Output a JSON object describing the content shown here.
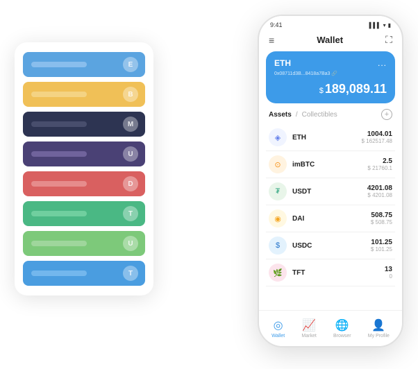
{
  "scene": {
    "cards": [
      {
        "color": "#5ba4e0",
        "textColor": "#a8d0f5",
        "dotLabel": "E"
      },
      {
        "color": "#f0c057",
        "textColor": "#f7e0a0",
        "dotLabel": "B"
      },
      {
        "color": "#2d3452",
        "textColor": "#5a6080",
        "dotLabel": "M"
      },
      {
        "color": "#4a4175",
        "textColor": "#8a7ab5",
        "dotLabel": "U"
      },
      {
        "color": "#d96060",
        "textColor": "#eeaaaa",
        "dotLabel": "D"
      },
      {
        "color": "#4ab884",
        "textColor": "#8addb0",
        "dotLabel": "T"
      },
      {
        "color": "#7dc97a",
        "textColor": "#b5e0b3",
        "dotLabel": "U"
      },
      {
        "color": "#4a9de0",
        "textColor": "#90c8f5",
        "dotLabel": "T"
      }
    ],
    "phone": {
      "status_time": "9:41",
      "status_signal": "▌▌▌",
      "status_wifi": "◈",
      "status_battery": "■",
      "header_menu_icon": "≡",
      "header_title": "Wallet",
      "header_scan_icon": "⛶",
      "eth_card": {
        "label": "ETH",
        "menu": "...",
        "address": "0x08711d3B...8418a7Ba3",
        "address_icon": "🔗",
        "currency_symbol": "$",
        "amount": "189,089.11",
        "background": "#3d9be9"
      },
      "assets": {
        "active_tab": "Assets",
        "divider": "/",
        "inactive_tab": "Collectibles",
        "add_icon": "+"
      },
      "tokens": [
        {
          "symbol": "ETH",
          "icon_char": "◈",
          "icon_bg": "#f0f4ff",
          "icon_color": "#627eea",
          "amount": "1004.01",
          "usd": "$ 162517.48"
        },
        {
          "symbol": "imBTC",
          "icon_char": "⊙",
          "icon_bg": "#fff3e0",
          "icon_color": "#f7931a",
          "amount": "2.5",
          "usd": "$ 21760.1"
        },
        {
          "symbol": "USDT",
          "icon_char": "₮",
          "icon_bg": "#e8f5e9",
          "icon_color": "#26a17b",
          "amount": "4201.08",
          "usd": "$ 4201.08"
        },
        {
          "symbol": "DAI",
          "icon_char": "◉",
          "icon_bg": "#fff8e1",
          "icon_color": "#f5a623",
          "amount": "508.75",
          "usd": "$ 508.75"
        },
        {
          "symbol": "USDC",
          "icon_char": "$",
          "icon_bg": "#e3f2fd",
          "icon_color": "#2775ca",
          "amount": "101.25",
          "usd": "$ 101.25"
        },
        {
          "symbol": "TFT",
          "icon_char": "🌿",
          "icon_bg": "#fce4ec",
          "icon_color": "#e91e8c",
          "amount": "13",
          "usd": "0"
        }
      ],
      "nav": [
        {
          "icon": "◎",
          "label": "Wallet",
          "active": true
        },
        {
          "icon": "📈",
          "label": "Market",
          "active": false
        },
        {
          "icon": "🌐",
          "label": "Browser",
          "active": false
        },
        {
          "icon": "👤",
          "label": "My Profile",
          "active": false
        }
      ]
    }
  }
}
